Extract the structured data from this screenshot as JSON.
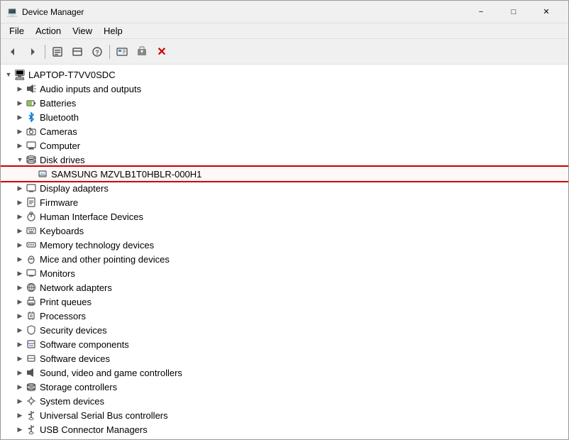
{
  "window": {
    "title": "Device Manager",
    "icon": "💻"
  },
  "menubar": {
    "items": [
      "File",
      "Action",
      "View",
      "Help"
    ]
  },
  "toolbar": {
    "buttons": [
      "◀",
      "▶",
      "🖥",
      "⬛",
      "❓",
      "⬛",
      "⬛",
      "🖥",
      "📄",
      "✖"
    ]
  },
  "tree": {
    "root": {
      "label": "LAPTOP-T7VV0SDC",
      "expanded": true
    },
    "items": [
      {
        "id": "audio",
        "label": "Audio inputs and outputs",
        "indent": 1,
        "icon": "🔊",
        "expanded": false,
        "highlighted": false
      },
      {
        "id": "batteries",
        "label": "Batteries",
        "indent": 1,
        "icon": "🔋",
        "expanded": false,
        "highlighted": false
      },
      {
        "id": "bluetooth",
        "label": "Bluetooth",
        "indent": 1,
        "icon": "📶",
        "expanded": false,
        "highlighted": false
      },
      {
        "id": "cameras",
        "label": "Cameras",
        "indent": 1,
        "icon": "📷",
        "expanded": false,
        "highlighted": false
      },
      {
        "id": "computer",
        "label": "Computer",
        "indent": 1,
        "icon": "🖥",
        "expanded": false,
        "highlighted": false
      },
      {
        "id": "disk",
        "label": "Disk drives",
        "indent": 1,
        "icon": "💾",
        "expanded": true,
        "highlighted": false
      },
      {
        "id": "samsung",
        "label": "SAMSUNG MZVLB1T0HBLR-000H1",
        "indent": 2,
        "icon": "💿",
        "expanded": false,
        "highlighted": true
      },
      {
        "id": "display",
        "label": "Display adapters",
        "indent": 1,
        "icon": "🖥",
        "expanded": false,
        "highlighted": false
      },
      {
        "id": "firmware",
        "label": "Firmware",
        "indent": 1,
        "icon": "📦",
        "expanded": false,
        "highlighted": false
      },
      {
        "id": "hid",
        "label": "Human Interface Devices",
        "indent": 1,
        "icon": "🖱",
        "expanded": false,
        "highlighted": false
      },
      {
        "id": "keyboards",
        "label": "Keyboards",
        "indent": 1,
        "icon": "⌨",
        "expanded": false,
        "highlighted": false
      },
      {
        "id": "memory",
        "label": "Memory technology devices",
        "indent": 1,
        "icon": "📋",
        "expanded": false,
        "highlighted": false
      },
      {
        "id": "mice",
        "label": "Mice and other pointing devices",
        "indent": 1,
        "icon": "🖱",
        "expanded": false,
        "highlighted": false
      },
      {
        "id": "monitors",
        "label": "Monitors",
        "indent": 1,
        "icon": "🖥",
        "expanded": false,
        "highlighted": false
      },
      {
        "id": "network",
        "label": "Network adapters",
        "indent": 1,
        "icon": "🌐",
        "expanded": false,
        "highlighted": false
      },
      {
        "id": "print",
        "label": "Print queues",
        "indent": 1,
        "icon": "🖨",
        "expanded": false,
        "highlighted": false
      },
      {
        "id": "processors",
        "label": "Processors",
        "indent": 1,
        "icon": "⚙",
        "expanded": false,
        "highlighted": false
      },
      {
        "id": "security",
        "label": "Security devices",
        "indent": 1,
        "icon": "🔒",
        "expanded": false,
        "highlighted": false
      },
      {
        "id": "software-components",
        "label": "Software components",
        "indent": 1,
        "icon": "📦",
        "expanded": false,
        "highlighted": false
      },
      {
        "id": "software-devices",
        "label": "Software devices",
        "indent": 1,
        "icon": "📦",
        "expanded": false,
        "highlighted": false
      },
      {
        "id": "sound",
        "label": "Sound, video and game controllers",
        "indent": 1,
        "icon": "🔊",
        "expanded": false,
        "highlighted": false
      },
      {
        "id": "storage",
        "label": "Storage controllers",
        "indent": 1,
        "icon": "💾",
        "expanded": false,
        "highlighted": false
      },
      {
        "id": "system",
        "label": "System devices",
        "indent": 1,
        "icon": "⚙",
        "expanded": false,
        "highlighted": false
      },
      {
        "id": "usb",
        "label": "Universal Serial Bus controllers",
        "indent": 1,
        "icon": "🔌",
        "expanded": false,
        "highlighted": false
      },
      {
        "id": "usb-connector",
        "label": "USB Connector Managers",
        "indent": 1,
        "icon": "🔌",
        "expanded": false,
        "highlighted": false
      }
    ]
  },
  "arrow": {
    "color": "#cc0000"
  }
}
